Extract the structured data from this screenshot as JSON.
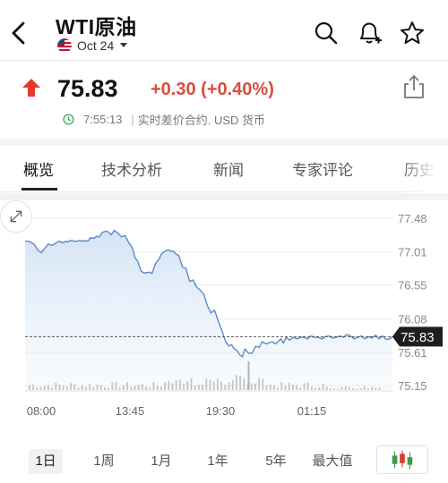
{
  "header": {
    "title": "WTI原油",
    "contract": "Oct 24",
    "icons": [
      "back-arrow-icon",
      "us-flag-icon",
      "caret-down-icon",
      "search-icon",
      "bell-plus-icon",
      "star-icon"
    ]
  },
  "quote": {
    "price": "75.83",
    "change": "+0.30 (+0.40%)",
    "time": "7:55:13",
    "info": "实时差价合约.  USD 货币",
    "direction_color": "#e8382b",
    "change_color": "#d64f3e"
  },
  "tabs": [
    {
      "label": "概览"
    },
    {
      "label": "技术分析"
    },
    {
      "label": "新闻"
    },
    {
      "label": "专家评论"
    },
    {
      "label": "历史数据"
    }
  ],
  "chart_data": {
    "type": "line",
    "series": [
      {
        "x": [
          0,
          4,
          7,
          10,
          14,
          18,
          22,
          26,
          30,
          34,
          38,
          42,
          46,
          48,
          50,
          52,
          55,
          58,
          60,
          62,
          64,
          66,
          68,
          71,
          73,
          76,
          78,
          80,
          83,
          86,
          90,
          93,
          96,
          100,
          104,
          108,
          112,
          116,
          120,
          123,
          126,
          130,
          133,
          136,
          139,
          142,
          145,
          147,
          150,
          152,
          154,
          157,
          160,
          163,
          166,
          169,
          172,
          176,
          180,
          184,
          188,
          192,
          196,
          200,
          204,
          208,
          212,
          216,
          220,
          224,
          228,
          231,
          234,
          237,
          240,
          243,
          246,
          250,
          254,
          258,
          262,
          265,
          268,
          271,
          274,
          277,
          280,
          283,
          286,
          289,
          292,
          296,
          300,
          304,
          308,
          312,
          316,
          320,
          324,
          328,
          332,
          336,
          340,
          344,
          348,
          352,
          356,
          360,
          364,
          368,
          372,
          376,
          380,
          384,
          388,
          392,
          396,
          400,
          404,
          408,
          411
        ],
        "values": [
          77.16,
          77.16,
          77.14,
          77.12,
          77.04,
          77.0,
          77.06,
          77.12,
          77.1,
          77.13,
          77.16,
          77.14,
          77.16,
          77.15,
          77.17,
          77.17,
          77.16,
          77.16,
          77.17,
          77.17,
          77.16,
          77.17,
          77.16,
          77.17,
          77.21,
          77.2,
          77.21,
          77.23,
          77.22,
          77.28,
          77.3,
          77.29,
          77.25,
          77.31,
          77.27,
          77.22,
          77.24,
          77.14,
          77.07,
          76.93,
          76.88,
          76.74,
          76.72,
          76.72,
          76.73,
          76.71,
          76.82,
          76.87,
          76.91,
          76.97,
          77.0,
          77.02,
          77.04,
          77.02,
          77.02,
          76.98,
          76.96,
          76.8,
          76.78,
          76.6,
          76.62,
          76.52,
          76.48,
          76.42,
          76.26,
          76.16,
          76.2,
          76.05,
          75.92,
          75.77,
          75.7,
          75.72,
          75.66,
          75.64,
          75.58,
          75.55,
          75.66,
          75.6,
          75.6,
          75.7,
          75.68,
          75.76,
          75.74,
          75.73,
          75.75,
          75.76,
          75.73,
          75.76,
          75.8,
          75.74,
          75.82,
          75.78,
          75.82,
          75.8,
          75.82,
          75.82,
          75.8,
          75.84,
          75.82,
          75.82,
          75.8,
          75.83,
          75.84,
          75.81,
          75.82,
          75.84,
          75.82,
          75.86,
          75.84,
          75.8,
          75.82,
          75.84,
          75.8,
          75.83,
          75.81,
          75.85,
          75.8,
          75.84,
          75.79,
          75.8,
          75.83
        ]
      }
    ],
    "x_tick_labels": [
      "08:00",
      "13:45",
      "19:30",
      "01:15"
    ],
    "y_tick_labels": [
      "77.48",
      "77.01",
      "76.55",
      "76.08",
      "75.61",
      "75.15"
    ],
    "ylim": [
      75.15,
      77.48
    ],
    "last_value": "75.83",
    "line_color": "#5b8ac7",
    "volume_color": "#aaaaaa",
    "grid": true
  },
  "ranges": [
    {
      "label": "1日"
    },
    {
      "label": "1周"
    },
    {
      "label": "1月"
    },
    {
      "label": "1年"
    },
    {
      "label": "5年"
    },
    {
      "label": "最大值"
    }
  ],
  "chart_type_icon": "candlestick-icon"
}
